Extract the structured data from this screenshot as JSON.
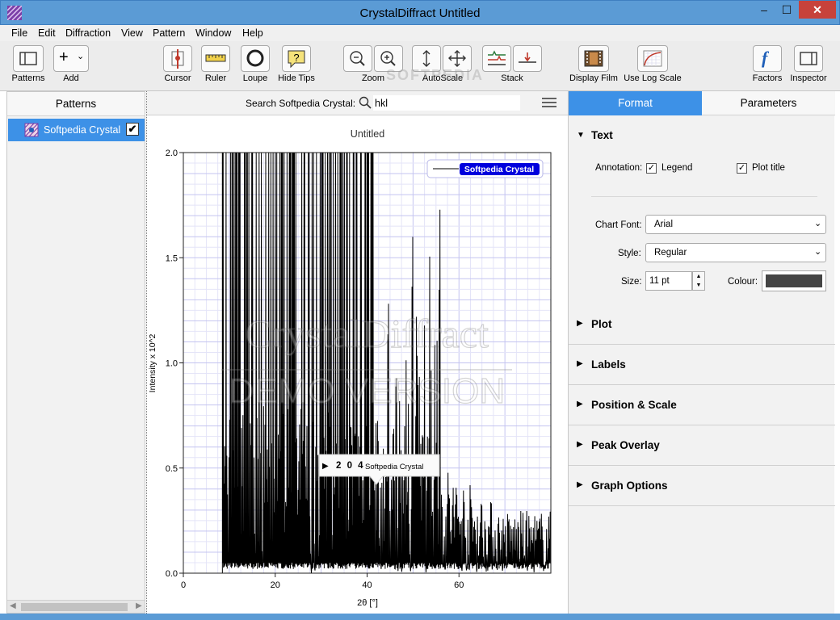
{
  "window": {
    "title": "CrystalDiffract Untitled",
    "min": "–",
    "max": "☐",
    "close": "✕"
  },
  "menu": [
    "File",
    "Edit",
    "Diffraction",
    "View",
    "Pattern",
    "Window",
    "Help"
  ],
  "toolbar": {
    "patterns": "Patterns",
    "add": "Add",
    "add_glyph": "+",
    "cursor": "Cursor",
    "ruler": "Ruler",
    "loupe": "Loupe",
    "hide_tips": "Hide Tips",
    "hide_tips_glyph": "?",
    "zoom": "Zoom",
    "autoscale": "AutoScale",
    "stack": "Stack",
    "display_film": "Display Film",
    "log_scale": "Use Log Scale",
    "factors": "Factors",
    "factors_glyph": "f",
    "inspector": "Inspector",
    "watermark": "SOFTPEDIA"
  },
  "patterns_panel": {
    "title": "Patterns",
    "items": [
      {
        "label": "Softpedia Crystal",
        "checked": "✔"
      }
    ]
  },
  "search": {
    "label": "Search Softpedia Crystal:",
    "value": "hkl",
    "icon": "search-icon"
  },
  "chart_data": {
    "type": "line",
    "title": "Untitled",
    "xlabel": "2θ [°]",
    "ylabel": "Intensity x 10^2",
    "xlim": [
      0,
      80
    ],
    "ylim": [
      0,
      2.0
    ],
    "x_ticks": [
      "0",
      "20",
      "40",
      "60"
    ],
    "y_ticks": [
      "0.0",
      "0.5",
      "1.0",
      "1.5",
      "2.0"
    ],
    "grid": true,
    "legend": {
      "placement": "top-right",
      "entries": [
        "Softpedia Crystal"
      ]
    },
    "series": [
      {
        "name": "Softpedia Crystal",
        "color": "#000000"
      }
    ],
    "watermark": [
      "CrystalDiffract",
      "DEMO VERSION"
    ],
    "tooltip": {
      "arrow": "▶",
      "hkl": "2 0 4",
      "pattern": "Softpedia Crystal"
    }
  },
  "inspector": {
    "tabs": [
      "Format",
      "Parameters"
    ],
    "text_section": {
      "title": "Text",
      "annotation_label": "Annotation:",
      "legend_label": "Legend",
      "plot_title_label": "Plot title",
      "chart_font_label": "Chart Font:",
      "chart_font_value": "Arial",
      "style_label": "Style:",
      "style_value": "Regular",
      "size_label": "Size:",
      "size_value": "11 pt",
      "colour_label": "Colour:",
      "colour_value": "#444444"
    },
    "sections": [
      "Plot",
      "Labels",
      "Position & Scale",
      "Peak Overlay",
      "Graph Options"
    ],
    "expanded_arrow": "▼",
    "collapsed_arrow": "▶"
  }
}
